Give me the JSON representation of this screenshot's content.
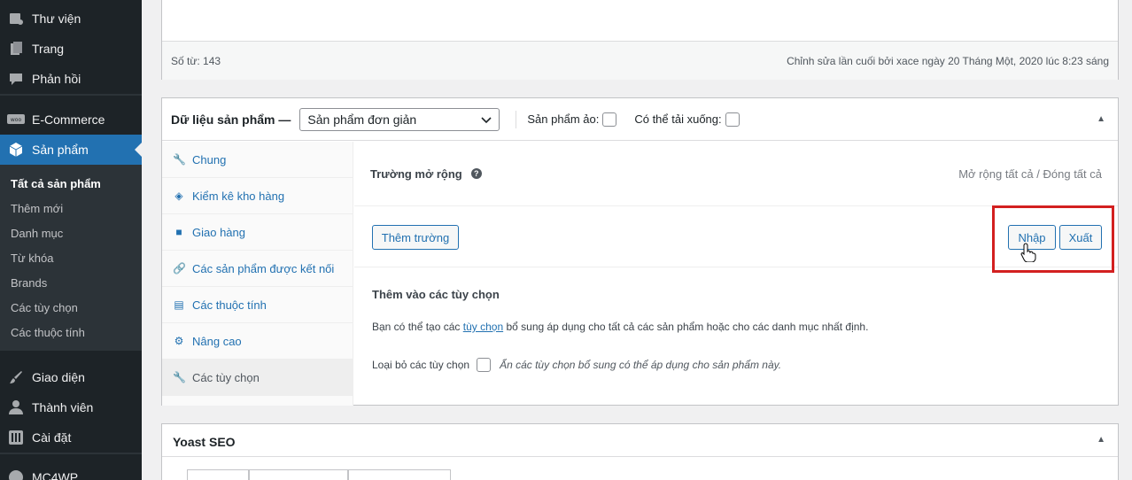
{
  "sidebar": {
    "items": [
      {
        "label": "Thư viện",
        "icon": "media-icon"
      },
      {
        "label": "Trang",
        "icon": "page-icon"
      },
      {
        "label": "Phản hồi",
        "icon": "comment-icon"
      },
      {
        "label": "E-Commerce",
        "icon": "woo-icon"
      },
      {
        "label": "Sản phẩm",
        "icon": "box-icon"
      },
      {
        "label": "Giao diện",
        "icon": "brush-icon"
      },
      {
        "label": "Thành viên",
        "icon": "user-icon"
      },
      {
        "label": "Cài đặt",
        "icon": "settings-icon"
      },
      {
        "label": "MC4WP",
        "icon": "mail-icon"
      }
    ],
    "submenu": [
      "Tất cả sản phẩm",
      "Thêm mới",
      "Danh mục",
      "Từ khóa",
      "Brands",
      "Các tùy chọn",
      "Các thuộc tính"
    ]
  },
  "editor": {
    "word_count": "Số từ: 143",
    "last_edited": "Chỉnh sửa lần cuối bởi xace ngày 20 Tháng Một, 2020 lúc 8:23 sáng"
  },
  "product_data": {
    "title": "Dữ liệu sản phẩm —",
    "type_value": "Sản phẩm đơn giản",
    "virtual_label": "Sản phẩm ảo:",
    "downloadable_label": "Có thể tải xuống:",
    "tabs": [
      "Chung",
      "Kiểm kê kho hàng",
      "Giao hàng",
      "Các sản phẩm được kết nối",
      "Các thuộc tính",
      "Nâng cao",
      "Các tùy chọn"
    ],
    "extended_fields_label": "Trường mở rộng",
    "expand_all": "Mở rộng tất cả",
    "slash": "/",
    "collapse_all": "Đóng tất cả",
    "add_field_button": "Thêm trường",
    "import_button": "Nhập",
    "export_button": "Xuất",
    "options_heading": "Thêm vào các tùy chọn",
    "desc_prefix": "Bạn có thể tạo các",
    "desc_link": "tùy chọn",
    "desc_suffix": "bổ sung áp dụng cho tất cả các sản phẩm hoặc cho các danh mục nhất định.",
    "exclude_label": "Loại bỏ các tùy chọn",
    "exclude_hint": "Ẩn các tùy chọn bổ sung có thể áp dụng cho sản phẩm này."
  },
  "yoast": {
    "title": "Yoast SEO"
  },
  "colors": {
    "sidebar_bg": "#1d2327",
    "accent": "#2271b1",
    "highlight": "#d32020"
  }
}
